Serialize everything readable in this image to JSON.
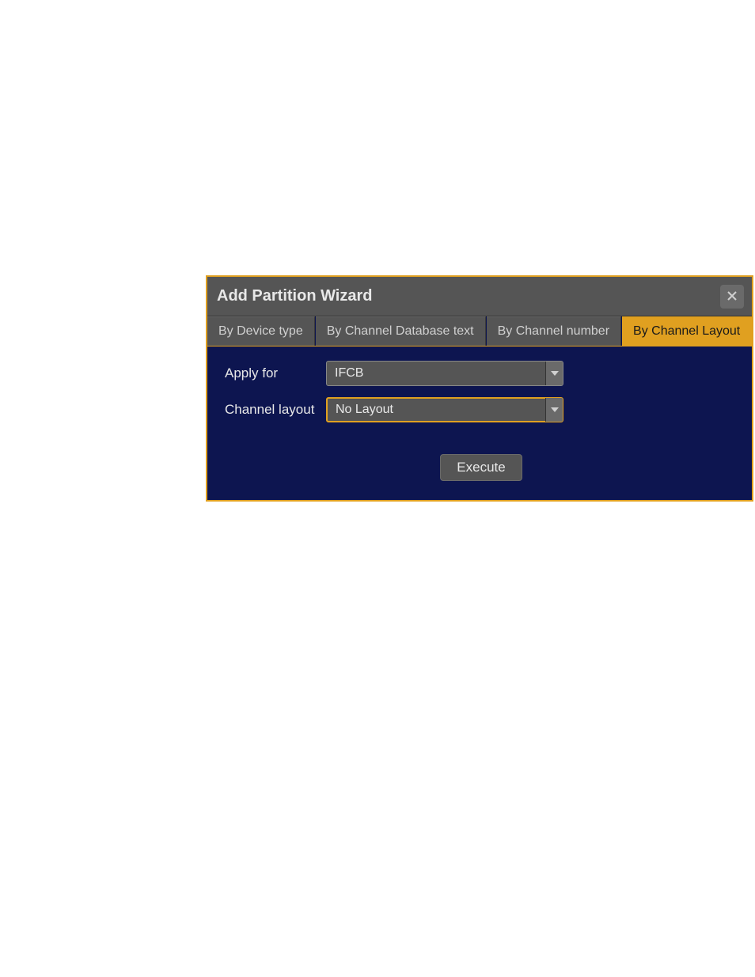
{
  "dialog": {
    "title": "Add Partition Wizard",
    "tabs": [
      {
        "label": "By Device type",
        "active": false
      },
      {
        "label": "By Channel Database text",
        "active": false
      },
      {
        "label": "By Channel number",
        "active": false
      },
      {
        "label": "By Channel Layout",
        "active": true
      }
    ],
    "fields": {
      "apply_for": {
        "label": "Apply for",
        "value": "IFCB"
      },
      "channel_layout": {
        "label": "Channel layout",
        "value": "No Layout"
      }
    },
    "execute_label": "Execute"
  }
}
